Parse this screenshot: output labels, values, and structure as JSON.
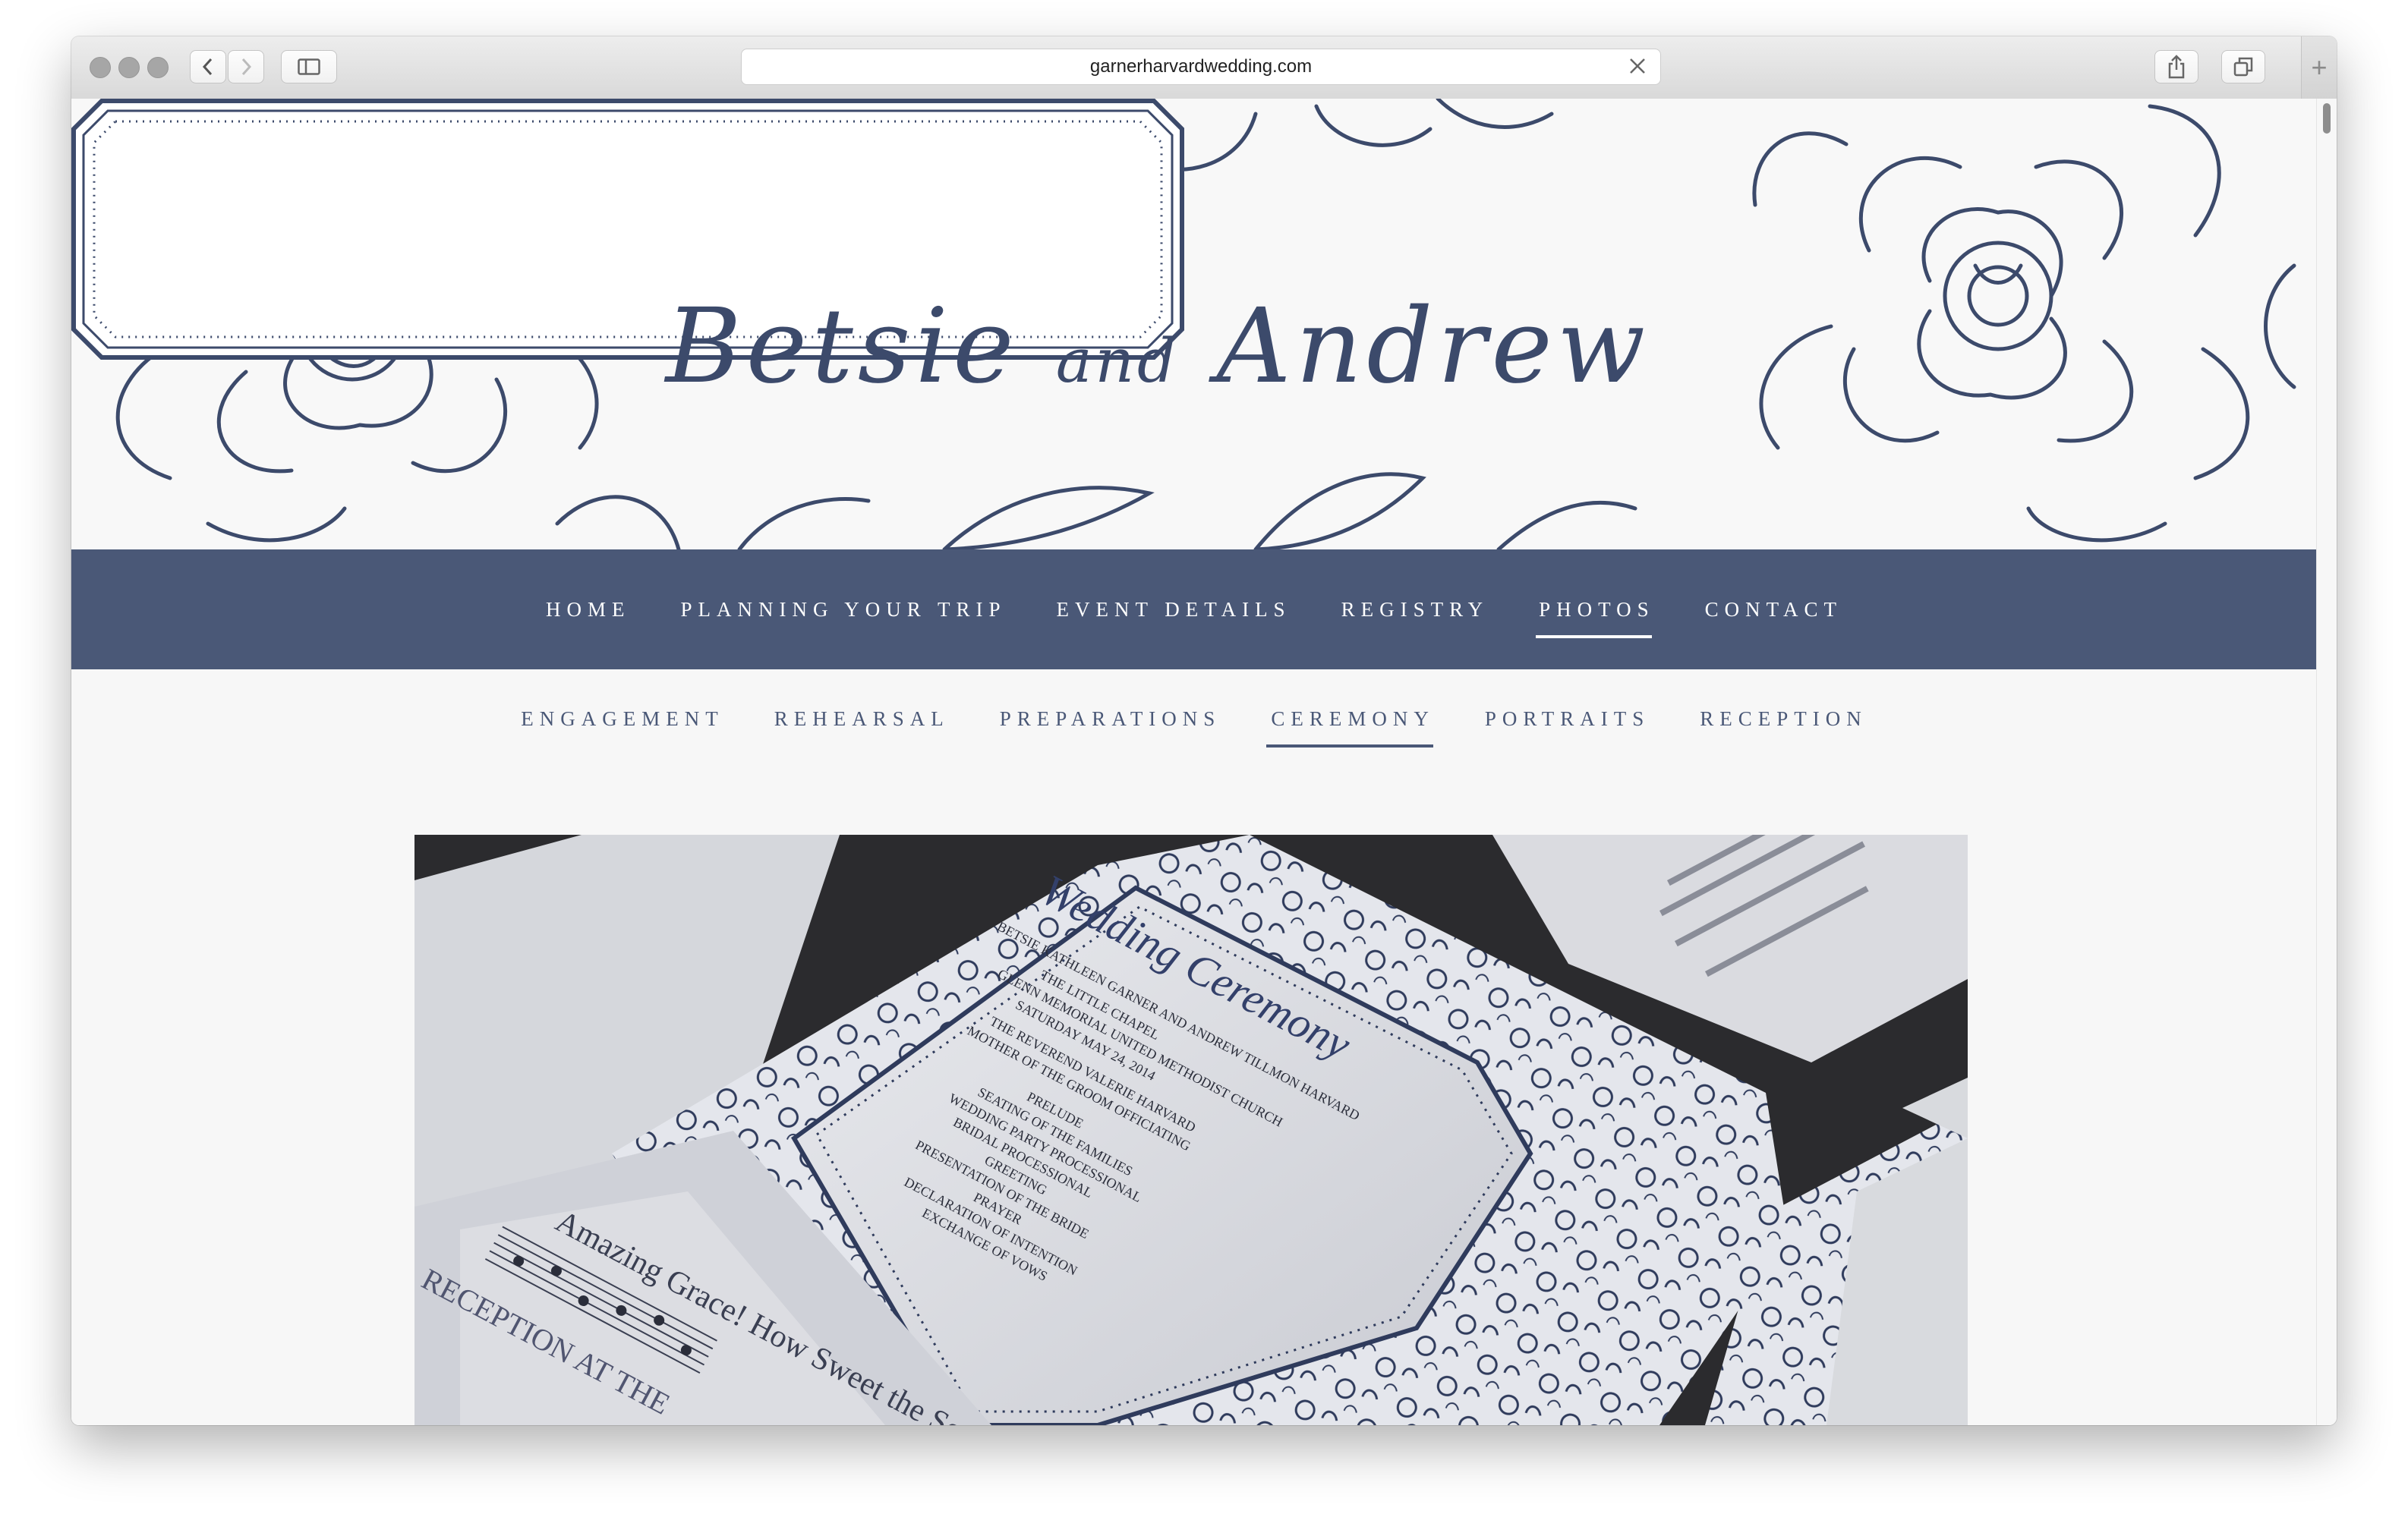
{
  "browser": {
    "url": "garnerharvardwedding.com",
    "icons": {
      "back": "chevron-left-icon",
      "forward": "chevron-right-icon",
      "sidebar": "sidebar-icon",
      "share": "share-icon",
      "tabs": "tabs-overview-icon",
      "close": "close-icon",
      "new_tab": "plus-icon"
    }
  },
  "header": {
    "title_first": "Betsie",
    "title_and": "and",
    "title_second": "Andrew"
  },
  "main_nav": {
    "items": [
      "HOME",
      "PLANNING YOUR TRIP",
      "EVENT DETAILS",
      "REGISTRY",
      "PHOTOS",
      "CONTACT"
    ],
    "active": "PHOTOS"
  },
  "sub_nav": {
    "items": [
      "ENGAGEMENT",
      "REHEARSAL",
      "PREPARATIONS",
      "CEREMONY",
      "PORTRAITS",
      "RECEPTION"
    ],
    "active": "CEREMONY"
  },
  "photo": {
    "card_title": "Wedding Ceremony",
    "card_lines": [
      "BETSIE KATHLEEN GARNER AND ANDREW TILLMON HARVARD",
      "THE LITTLE CHAPEL",
      "GLENN MEMORIAL UNITED METHODIST CHURCH",
      "SATURDAY MAY 24, 2014",
      "THE REVEREND VALERIE HARVARD",
      "MOTHER OF THE GROOM OFFICIATING",
      "PRELUDE",
      "SEATING OF THE FAMILIES",
      "WEDDING PARTY PROCESSIONAL",
      "BRIDAL PROCESSIONAL",
      "GREETING",
      "PRESENTATION OF THE BRIDE",
      "PRAYER",
      "DECLARATION OF INTENTION",
      "EXCHANGE OF VOWS"
    ],
    "hymn_title": "Amazing Grace! How Sweet the Sound",
    "reception_heading": "RECEPTION AT THE",
    "colors": {
      "navy": "#3c4a6b",
      "card": "#dfe0e4",
      "background": "#2a2a2c"
    }
  },
  "colors": {
    "nav_bg": "#4a5877",
    "accent": "#3c4a6b",
    "page_bg": "#f7f7f7"
  }
}
